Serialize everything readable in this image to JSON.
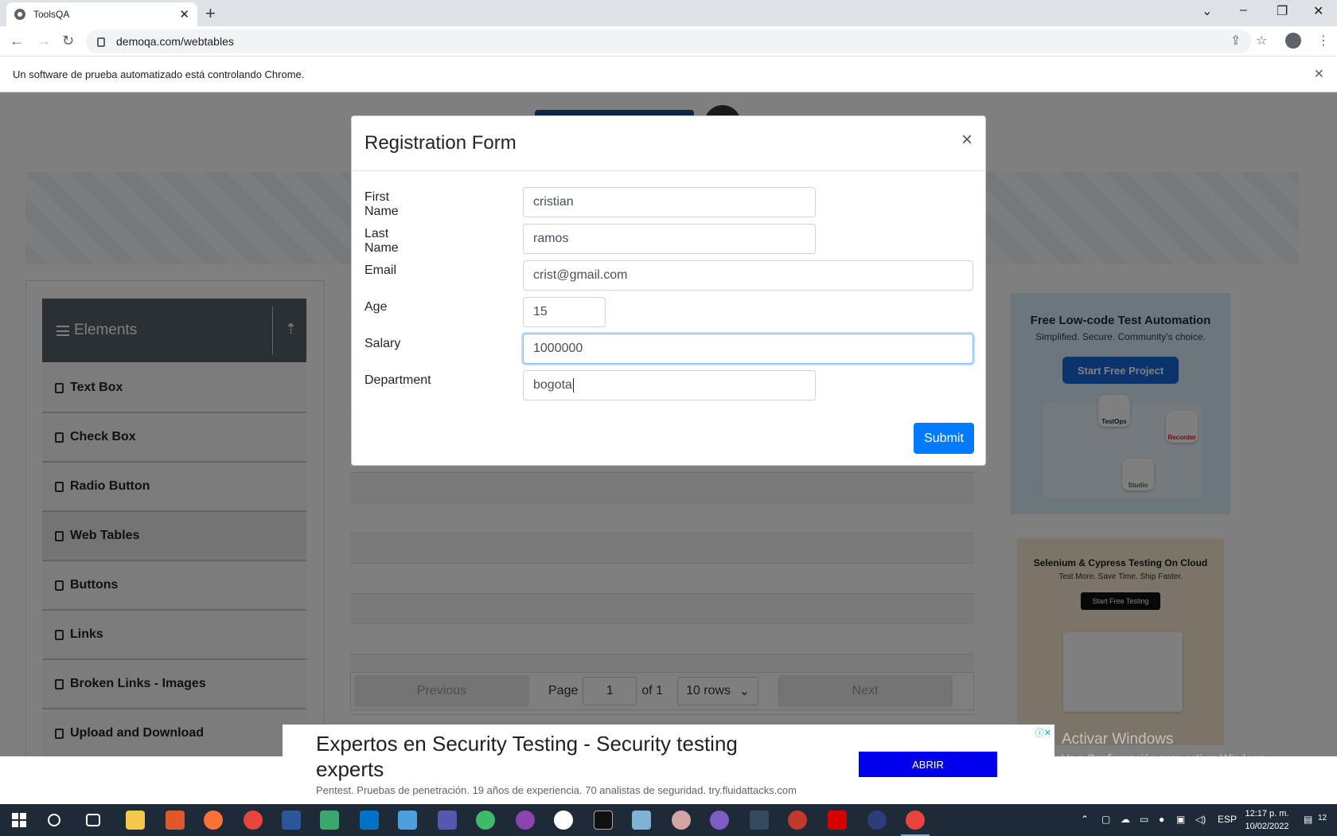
{
  "browser": {
    "tab_title": "ToolsQA",
    "url": "demoqa.com/webtables",
    "infobar_text": "Un software de prueba automatizado está controlando Chrome."
  },
  "sidebar": {
    "group_label": "Elements",
    "items": [
      {
        "label": "Text Box"
      },
      {
        "label": "Check Box"
      },
      {
        "label": "Radio Button"
      },
      {
        "label": "Web Tables",
        "active": true
      },
      {
        "label": "Buttons"
      },
      {
        "label": "Links"
      },
      {
        "label": "Broken Links - Images"
      },
      {
        "label": "Upload and Download"
      }
    ]
  },
  "pagination": {
    "previous": "Previous",
    "page_label": "Page",
    "page_value": "1",
    "of_label": "of 1",
    "rows_option": "10 rows",
    "next": "Next"
  },
  "modal": {
    "title": "Registration Form",
    "fields": {
      "first_name": {
        "label": "First Name",
        "value": "cristian"
      },
      "last_name": {
        "label": "Last Name",
        "value": "ramos"
      },
      "email": {
        "label": "Email",
        "value": "crist@gmail.com"
      },
      "age": {
        "label": "Age",
        "value": "15"
      },
      "salary": {
        "label": "Salary",
        "value": "1000000"
      },
      "department": {
        "label": "Department",
        "value": "bogota"
      }
    },
    "submit_label": "Submit"
  },
  "ads": {
    "right_top": {
      "title": "Free Low-code Test Automation",
      "subtitle": "Simplified. Secure. Community's choice.",
      "button": "Start Free Project",
      "chips": [
        "TestOps",
        "Recorder",
        "Studio"
      ]
    },
    "right_bottom": {
      "title": "Selenium & Cypress Testing On Cloud",
      "subtitle": "Test More. Save Time. Ship Faster.",
      "button": "Start Free Testing"
    },
    "bottom": {
      "headline": "Expertos en Security Testing - Security testing experts",
      "description": "Pentest. Pruebas de penetración. 19 años de experiencia. 70 analistas de seguridad. try.fluidattacks.com",
      "button": "ABRIR"
    }
  },
  "watermark": {
    "line1": "Activar Windows",
    "line2": "Ve a Configuración para activar Windows."
  },
  "taskbar": {
    "language": "ESP",
    "time": "12:17 p. m.",
    "date": "10/02/2022",
    "notifications": "12"
  },
  "colors": {
    "primary": "#007bff",
    "sidebar_header": "#56606b",
    "taskbar": "#1f2a38"
  }
}
